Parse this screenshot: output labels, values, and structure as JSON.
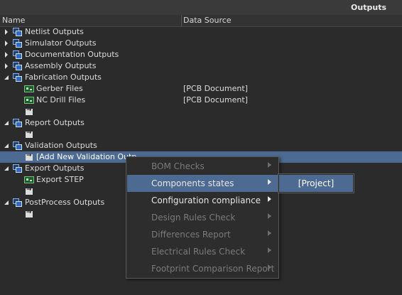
{
  "panel": {
    "title": "Outputs"
  },
  "columns": {
    "name": "Name",
    "data_source": "Data Source"
  },
  "tree": {
    "netlist": "Netlist Outputs",
    "simulator": "Simulator Outputs",
    "documentation": "Documentation Outputs",
    "assembly": "Assembly Outputs",
    "fabrication": "Fabrication Outputs",
    "gerber": {
      "label": "Gerber Files",
      "source": "[PCB Document]"
    },
    "nc_drill": {
      "label": "NC Drill Files",
      "source": "[PCB Document]"
    },
    "report": "Report Outputs",
    "validation": "Validation Outputs",
    "add_validation": "[Add New Validation Outp",
    "export": "Export Outputs",
    "export_step": "Export STEP",
    "postprocess": "PostProcess Outputs"
  },
  "context_menu": {
    "items": [
      {
        "label": "BOM Checks",
        "enabled": false
      },
      {
        "label": "Components states",
        "enabled": true,
        "highlighted": true
      },
      {
        "label": "Configuration compliance",
        "enabled": true
      },
      {
        "label": "Design Rules Check",
        "enabled": false
      },
      {
        "label": "Differences Report",
        "enabled": false
      },
      {
        "label": "Electrical Rules Check",
        "enabled": false
      },
      {
        "label": "Footprint Comparison Report",
        "enabled": false
      }
    ]
  },
  "submenu": {
    "item": "[Project]"
  },
  "colors": {
    "background": "#2b2b2b",
    "selection": "#4c6a92",
    "text": "#dcdcdc",
    "disabled_text": "#7a7a7a"
  }
}
